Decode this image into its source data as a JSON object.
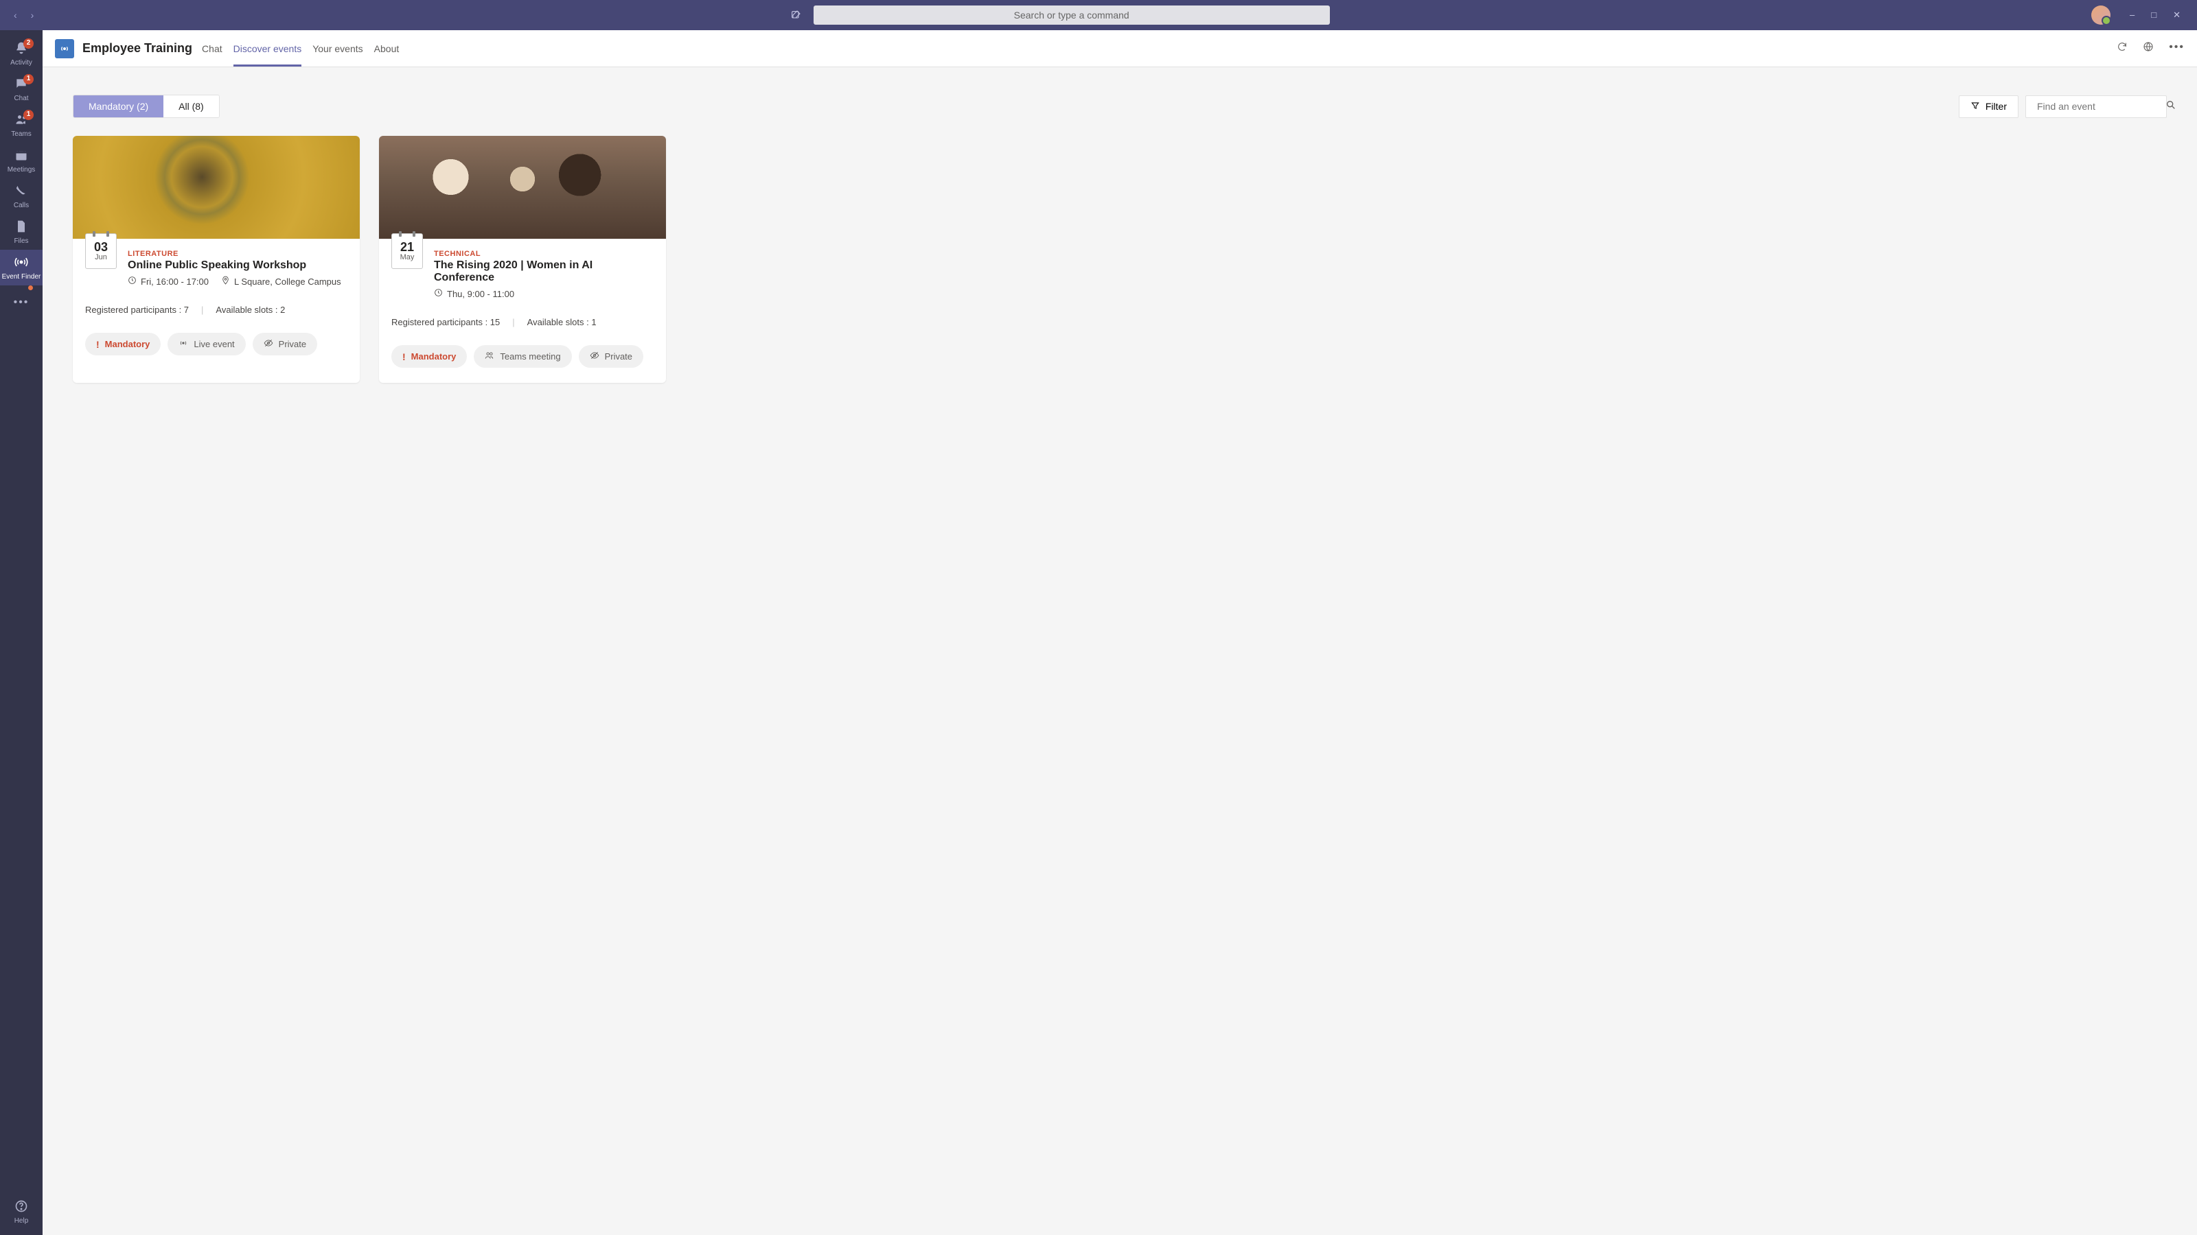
{
  "titlebar": {
    "search_placeholder": "Search or type a command"
  },
  "rail": {
    "items": [
      {
        "id": "activity",
        "label": "Activity",
        "badge": "2"
      },
      {
        "id": "chat",
        "label": "Chat",
        "badge": "1"
      },
      {
        "id": "teams",
        "label": "Teams",
        "badge": "1"
      },
      {
        "id": "meetings",
        "label": "Meetings",
        "badge": null
      },
      {
        "id": "calls",
        "label": "Calls",
        "badge": null
      },
      {
        "id": "files",
        "label": "Files",
        "badge": null
      },
      {
        "id": "event-finder",
        "label": "Event Finder",
        "badge": null,
        "active": true
      },
      {
        "id": "more",
        "label": "",
        "badge": null,
        "dot": true
      }
    ],
    "help_label": "Help"
  },
  "header": {
    "app_title": "Employee Training",
    "tabs": [
      {
        "id": "chat",
        "label": "Chat"
      },
      {
        "id": "discover",
        "label": "Discover events",
        "active": true
      },
      {
        "id": "your",
        "label": "Your events"
      },
      {
        "id": "about",
        "label": "About"
      }
    ]
  },
  "controls": {
    "segments": [
      {
        "id": "mandatory",
        "label": "Mandatory (2)",
        "active": true
      },
      {
        "id": "all",
        "label": "All (8)"
      }
    ],
    "filter_label": "Filter",
    "search_placeholder": "Find an event"
  },
  "events": [
    {
      "day": "03",
      "month": "Jun",
      "category": "LITERATURE",
      "title": "Online Public Speaking Workshop",
      "time": "Fri, 16:00 - 17:00",
      "location": "L Square, College Campus",
      "registered_label": "Registered participants : 7",
      "slots_label": "Available slots : 2",
      "chips": [
        {
          "id": "mandatory",
          "label": "Mandatory",
          "kind": "mandatory"
        },
        {
          "id": "live",
          "label": "Live event",
          "kind": "live"
        },
        {
          "id": "private",
          "label": "Private",
          "kind": "private"
        }
      ]
    },
    {
      "day": "21",
      "month": "May",
      "category": "TECHNICAL",
      "title": "The Rising 2020 | Women in AI Conference",
      "time": "Thu, 9:00 - 11:00",
      "location": "",
      "registered_label": "Registered participants : 15",
      "slots_label": "Available slots : 1",
      "chips": [
        {
          "id": "mandatory",
          "label": "Mandatory",
          "kind": "mandatory"
        },
        {
          "id": "teams",
          "label": "Teams meeting",
          "kind": "teams"
        },
        {
          "id": "private",
          "label": "Private",
          "kind": "private"
        }
      ]
    }
  ]
}
